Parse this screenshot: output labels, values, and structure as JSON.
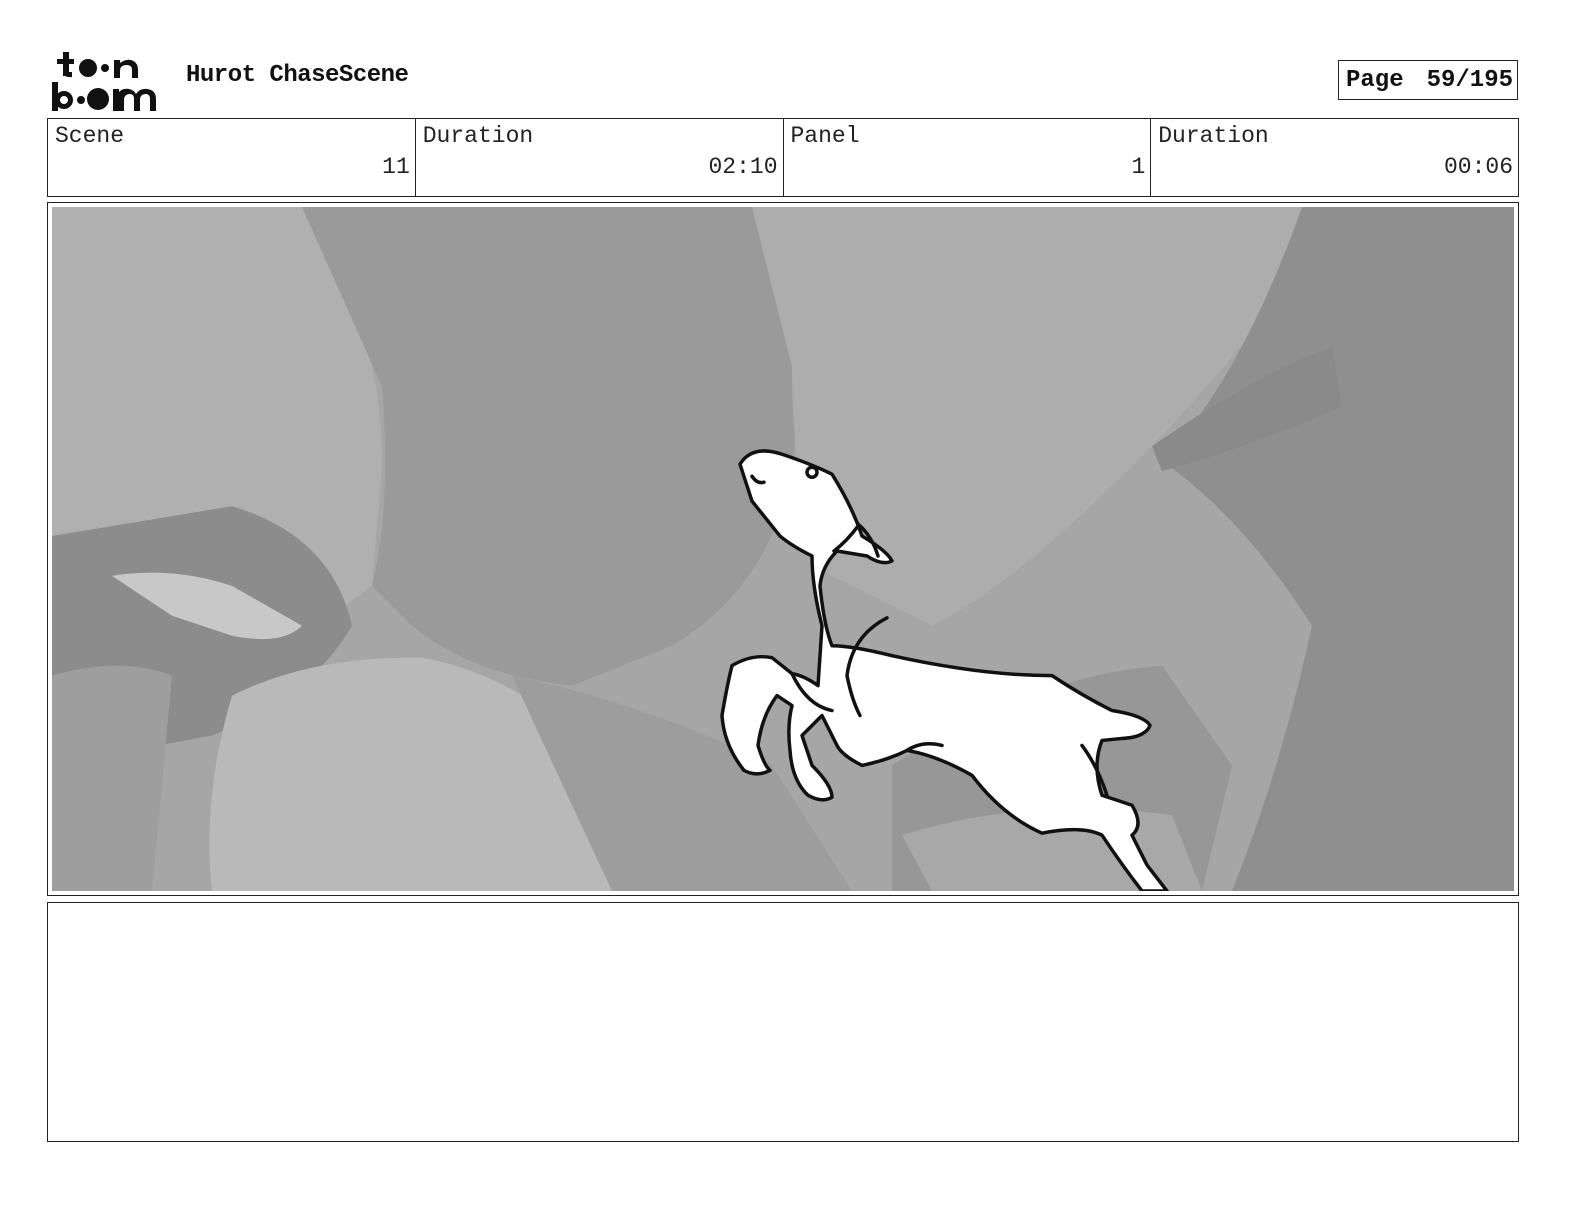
{
  "header": {
    "logo_icon": "toonboom-logo",
    "logo_text": "toon boom",
    "project_title": "Hurot ChaseScene",
    "page_label": "Page",
    "page_value": "59/195"
  },
  "info": {
    "scene_label": "Scene",
    "scene_value": "11",
    "scene_duration_label": "Duration",
    "scene_duration_value": "02:10",
    "panel_label": "Panel",
    "panel_value": "1",
    "panel_duration_label": "Duration",
    "panel_duration_value": "00:06"
  },
  "frame": {
    "image_subject": "horse-leaping-sketch"
  },
  "notes": {
    "text": ""
  }
}
